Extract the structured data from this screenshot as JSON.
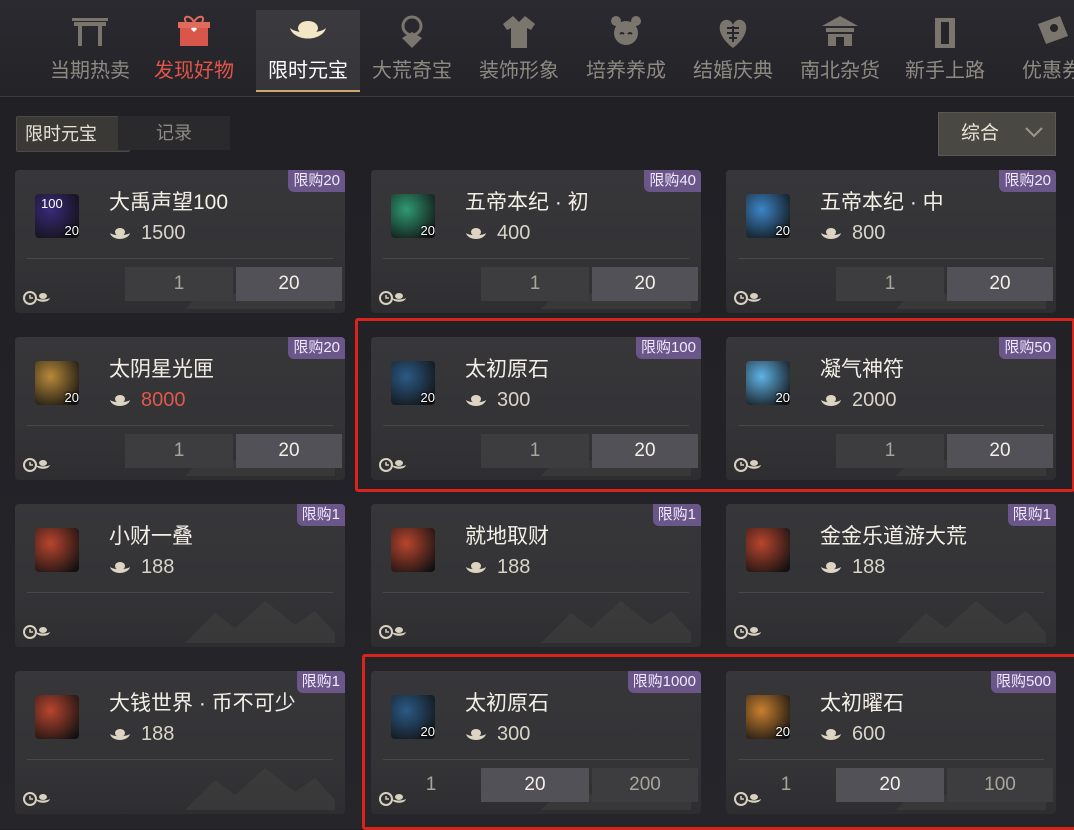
{
  "tabs": [
    {
      "label": "当期热卖",
      "icon": "gate-icon"
    },
    {
      "label": "发现好物",
      "icon": "gift-box-icon"
    },
    {
      "label": "限时元宝",
      "icon": "gold-ingot-icon"
    },
    {
      "label": "大荒奇宝",
      "icon": "treasure-pendant-icon"
    },
    {
      "label": "装饰形象",
      "icon": "robe-icon"
    },
    {
      "label": "培养养成",
      "icon": "pet-face-icon"
    },
    {
      "label": "结婚庆典",
      "icon": "double-happiness-icon"
    },
    {
      "label": "南北杂货",
      "icon": "shop-building-icon"
    },
    {
      "label": "新手上路",
      "icon": "door-icon"
    },
    {
      "label": "优惠券",
      "icon": "coupon-icon"
    }
  ],
  "subtabs": {
    "active": "限时元宝",
    "other": "记录"
  },
  "sort": {
    "label": "综合",
    "chevron": "chevron-down-icon"
  },
  "items": [
    {
      "name": "大禹声望100",
      "price": "1500",
      "limit": "限购20",
      "count": "20",
      "qty": [
        "1",
        "20"
      ],
      "icon_label": "100",
      "icon_color": "#3a2a7a",
      "price_red": false
    },
    {
      "name": "五帝本纪 · 初",
      "price": "400",
      "limit": "限购40",
      "count": "20",
      "qty": [
        "1",
        "20"
      ],
      "icon_color": "#2f9a74",
      "price_red": false
    },
    {
      "name": "五帝本纪 · 中",
      "price": "800",
      "limit": "限购20",
      "count": "20",
      "qty": [
        "1",
        "20"
      ],
      "icon_color": "#3c86c8",
      "price_red": false
    },
    {
      "name": "太阴星光匣",
      "price": "8000",
      "limit": "限购20",
      "count": "20",
      "qty": [
        "1",
        "20"
      ],
      "icon_color": "#b88a3a",
      "price_red": true
    },
    {
      "name": "太初原石",
      "price": "300",
      "limit": "限购100",
      "count": "20",
      "qty": [
        "1",
        "20"
      ],
      "icon_color": "#2b5a86",
      "price_red": false
    },
    {
      "name": "凝气神符",
      "price": "2000",
      "limit": "限购50",
      "count": "20",
      "qty": [
        "1",
        "20"
      ],
      "icon_color": "#5fb3e6",
      "price_red": false
    },
    {
      "name": "小财一叠",
      "price": "188",
      "limit": "限购1",
      "qty": [],
      "icon_color": "#b8452e",
      "price_red": false
    },
    {
      "name": "就地取财",
      "price": "188",
      "limit": "限购1",
      "qty": [],
      "icon_color": "#b8452e",
      "price_red": false
    },
    {
      "name": "金金乐道游大荒",
      "price": "188",
      "limit": "限购1",
      "qty": [],
      "icon_color": "#b8452e",
      "price_red": false
    },
    {
      "name": "大钱世界 · 币不可少",
      "price": "188",
      "limit": "限购1",
      "qty": [],
      "icon_color": "#b8452e",
      "price_red": false
    },
    {
      "name": "太初原石",
      "price": "300",
      "limit": "限购1000",
      "count": "20",
      "qty": [
        "1",
        "20",
        "200"
      ],
      "icon_color": "#2b5a86",
      "price_red": false
    },
    {
      "name": "太初曜石",
      "price": "600",
      "limit": "限购500",
      "count": "20",
      "qty": [
        "1",
        "20",
        "100"
      ],
      "icon_color": "#c9802f",
      "price_red": false
    }
  ],
  "colors": {
    "accent": "#c9a96c",
    "limit_badge": "#6a5688",
    "highlight": "#d7251c",
    "price_red": "#e0584c"
  }
}
